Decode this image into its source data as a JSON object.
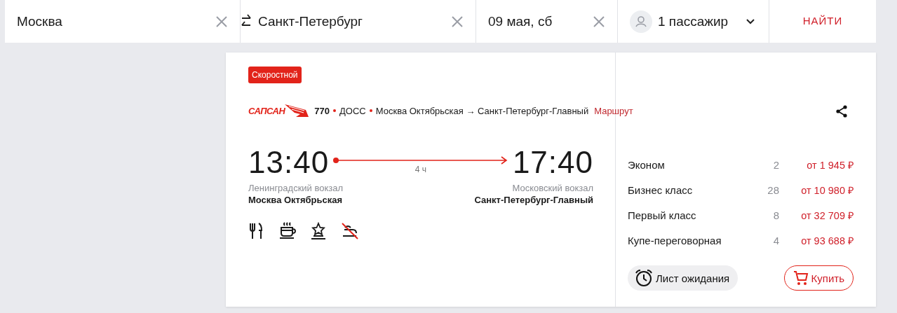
{
  "search": {
    "from": {
      "value": "Москва"
    },
    "to": {
      "value": "Санкт-Петербург"
    },
    "date": {
      "value": "09 мая, сб"
    },
    "passengers": {
      "value": "1 пассажир"
    },
    "submit": "НАЙТИ"
  },
  "train": {
    "badge": "Скоростной",
    "logo": "САПСАН",
    "number": "770",
    "type": "ДОСС",
    "route": "Москва Октябрьская → Санкт-Петербург-Главный",
    "route_link": "Маршрут",
    "departure": {
      "time": "13:40",
      "station": "Ленинградский вокзал",
      "city": "Москва Октябрьская"
    },
    "duration": "4 ч",
    "arrival": {
      "time": "17:40",
      "station": "Московский вокзал",
      "city": "Санкт-Петербург-Главный"
    },
    "amenities": [
      {
        "kind": "restaurant",
        "available": true
      },
      {
        "kind": "coffee",
        "available": true
      },
      {
        "kind": "service",
        "available": true
      },
      {
        "kind": "smoking",
        "available": false
      }
    ],
    "classes": [
      {
        "name": "Эконом",
        "seats": "2",
        "price": "от 1 945 ₽"
      },
      {
        "name": "Бизнес класс",
        "seats": "28",
        "price": "от 10 980 ₽"
      },
      {
        "name": "Первый класс",
        "seats": "8",
        "price": "от 32 709 ₽"
      },
      {
        "name": "Купе-переговорная",
        "seats": "4",
        "price": "от 93 688 ₽"
      }
    ],
    "waitlist_button": "Лист ожидания",
    "buy_button": "Купить"
  }
}
